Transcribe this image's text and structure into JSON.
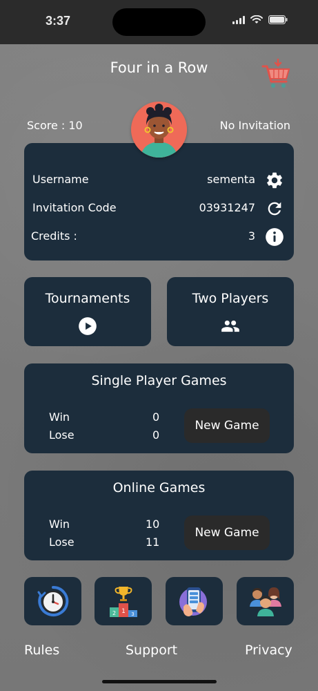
{
  "status_bar": {
    "time": "3:37"
  },
  "header": {
    "title": "Four in a Row"
  },
  "top": {
    "score": "Score : 10",
    "invitation_status": "No Invitation"
  },
  "account": {
    "username_label": "Username",
    "username_value": "sementa",
    "invitation_code_label": "Invitation Code",
    "invitation_code_value": "03931247",
    "credits_label": "Credits :",
    "credits_value": "3"
  },
  "modes": {
    "tournaments_label": "Tournaments",
    "two_players_label": "Two Players"
  },
  "single_player": {
    "title": "Single Player Games",
    "win_label": "Win",
    "win_value": "0",
    "lose_label": "Lose",
    "lose_value": "0",
    "new_game_label": "New Game"
  },
  "online": {
    "title": "Online Games",
    "win_label": "Win",
    "win_value": "10",
    "lose_label": "Lose",
    "lose_value": "11",
    "new_game_label": "New Game"
  },
  "footer": {
    "rules_label": "Rules",
    "support_label": "Support",
    "privacy_label": "Privacy"
  },
  "icons": {
    "shop": "shopping-cart-icon",
    "settings": "gear-icon",
    "refresh": "refresh-icon",
    "info": "info-icon",
    "play": "play-icon",
    "group": "group-icon",
    "history": "history-clock-icon",
    "leaderboard": "podium-trophy-icon",
    "phone": "phone-hand-icon",
    "friends": "friends-icon"
  },
  "colors": {
    "card": "#1c2d3c",
    "button_dark": "#2a2a2a",
    "avatar_bg": "#ef6a58",
    "background": "#7b7b7b"
  }
}
